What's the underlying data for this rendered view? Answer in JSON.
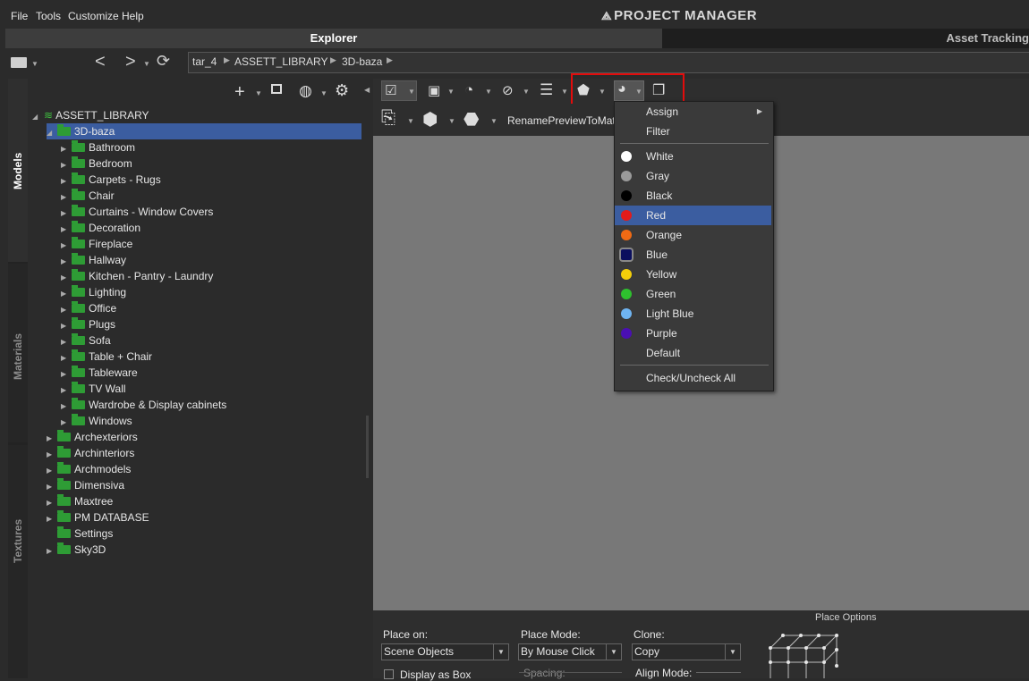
{
  "menubar": {
    "items": [
      "File",
      "Tools",
      "Customize",
      "Help"
    ],
    "logo": "PROJECT MANAGER"
  },
  "tabs": {
    "explorer": "Explorer",
    "asset_tracking": "Asset Tracking"
  },
  "breadcrumb": [
    "tar_4",
    "ASSETT_LIBRARY",
    "3D-baza"
  ],
  "side_tabs": {
    "models": "Models",
    "materials": "Materials",
    "textures": "Textures"
  },
  "tree": {
    "root": "ASSETT_LIBRARY",
    "selected": "3D-baza",
    "children": [
      "Bathroom",
      "Bedroom",
      "Carpets - Rugs",
      "Chair",
      "Curtains - Window Covers",
      "Decoration",
      "Fireplace",
      "Hallway",
      "Kitchen - Pantry - Laundry",
      "Lighting",
      "Office",
      "Plugs",
      "Sofa",
      "Table + Chair",
      "Tableware",
      "TV Wall",
      "Wardrobe & Display cabinets",
      "Windows"
    ],
    "siblings": [
      "Archexteriors",
      "Archinteriors",
      "Archmodels",
      "Dimensiva",
      "Maxtree",
      "PM DATABASE",
      "Settings",
      "Sky3D"
    ]
  },
  "toolbar": {
    "rename_preview": "RenamePreviewToMate"
  },
  "dropdown": {
    "assign": "Assign",
    "filter": "Filter",
    "colors": [
      {
        "label": "White",
        "color": "#ffffff"
      },
      {
        "label": "Gray",
        "color": "#9a9a9a"
      },
      {
        "label": "Black",
        "color": "#000000"
      },
      {
        "label": "Red",
        "color": "#e21b1b"
      },
      {
        "label": "Orange",
        "color": "#f06a14"
      },
      {
        "label": "Blue",
        "color": "#0b0f5e"
      },
      {
        "label": "Yellow",
        "color": "#f4cf0a"
      },
      {
        "label": "Green",
        "color": "#2ec02e"
      },
      {
        "label": "Light Blue",
        "color": "#6fb4f2"
      },
      {
        "label": "Purple",
        "color": "#4a0fb3"
      }
    ],
    "default": "Default",
    "check_all": "Check/Uncheck All",
    "highlighted": "Red"
  },
  "place_options": {
    "title": "Place Options",
    "place_on_label": "Place on:",
    "place_on_value": "Scene Objects",
    "place_mode_label": "Place Mode:",
    "place_mode_value": "By Mouse Click",
    "clone_label": "Clone:",
    "clone_value": "Copy",
    "display_as_box": "Display as Box",
    "spacing_label": "Spacing:",
    "align_mode_label": "Align Mode:"
  }
}
